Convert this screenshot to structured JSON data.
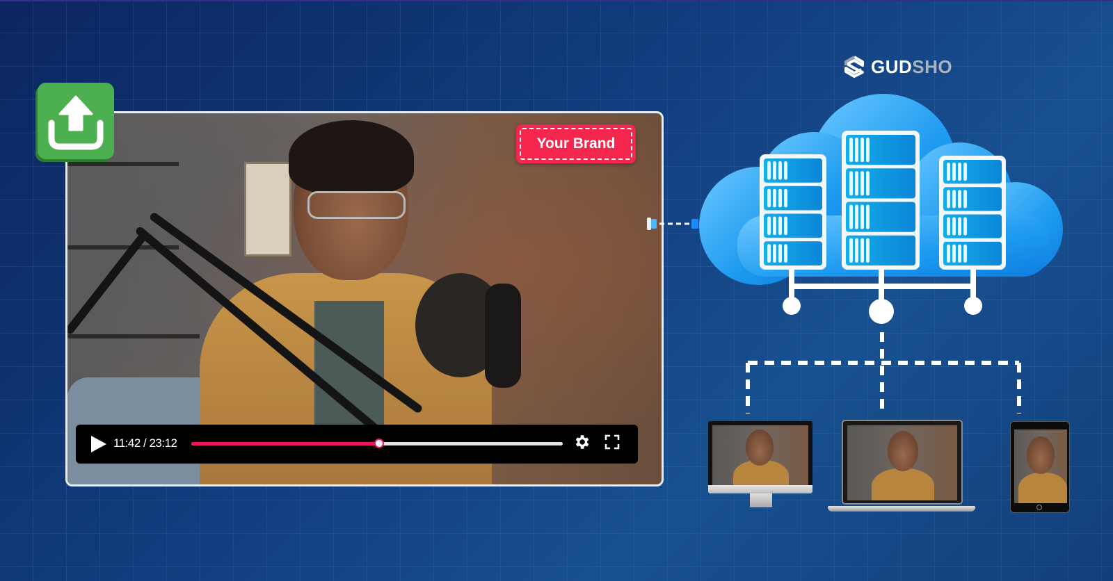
{
  "brand": {
    "logo_part1": "GUD",
    "logo_part2": "SHO",
    "logo_icon": "gudsho-logo-icon"
  },
  "upload_button": {
    "icon": "upload-icon",
    "color": "#4caf50"
  },
  "video_player": {
    "watermark_label": "Your Brand",
    "watermark_color": "#f5274f",
    "current_time": "11:42",
    "total_time": "23:12",
    "time_display": "11:42 / 23:12",
    "progress_fraction": 0.505,
    "progress_color": "#f0165c",
    "controls": {
      "play_icon": "play-icon",
      "settings_icon": "gear-icon",
      "fullscreen_icon": "fullscreen-icon"
    }
  },
  "cloud": {
    "server_racks": 3,
    "units_per_rack": 4,
    "color": "#1e9bf0"
  },
  "devices": [
    {
      "type": "desktop-monitor"
    },
    {
      "type": "laptop"
    },
    {
      "type": "tablet"
    }
  ],
  "colors": {
    "background": "#0d2b63",
    "connector": "#ffffff"
  }
}
